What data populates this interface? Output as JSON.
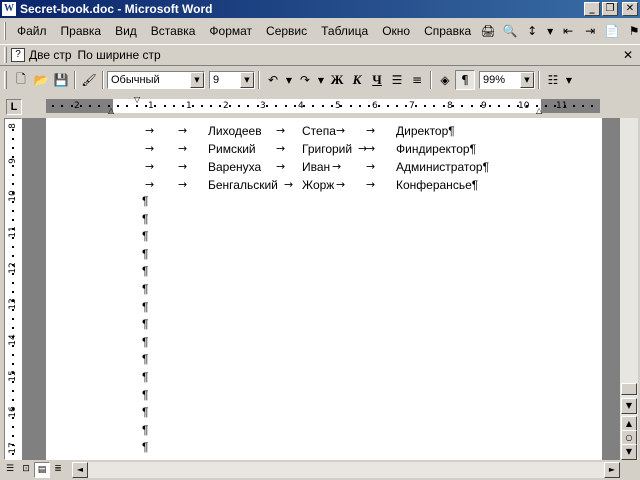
{
  "window": {
    "title": "Secret-book.doc - Microsoft Word",
    "app_icon_letter": "W",
    "minimize_glyph": "_",
    "restore_glyph": "❐",
    "close_glyph": "✕"
  },
  "menu": {
    "items": [
      {
        "label": "Файл"
      },
      {
        "label": "Правка"
      },
      {
        "label": "Вид"
      },
      {
        "label": "Вставка"
      },
      {
        "label": "Формат"
      },
      {
        "label": "Сервис"
      },
      {
        "label": "Таблица"
      },
      {
        "label": "Окно"
      },
      {
        "label": "Справка"
      }
    ],
    "tool_icons": [
      "print-preview-icon",
      "spellcheck-icon",
      "line-spacing-icon",
      "decrease-indent-icon",
      "increase-indent-icon",
      "pdf-icon",
      "bookmark-icon"
    ]
  },
  "reading_toolbar": {
    "two_pages": "Две стр",
    "fit_width": "По ширине стр",
    "close_glyph": "✕"
  },
  "format_toolbar": {
    "style": "Обычный",
    "font_size": "9",
    "bold": "Ж",
    "italic": "К",
    "underline": "Ч",
    "pilcrow": "¶",
    "zoom": "99%"
  },
  "ruler": {
    "tab_selector": "L",
    "numbers": [
      "2",
      "1",
      "1",
      "2",
      "3",
      "4",
      "5",
      "6",
      "7",
      "8",
      "9",
      "10",
      "11",
      "12"
    ]
  },
  "vruler": {
    "numbers": [
      "8",
      "9",
      "10",
      "11",
      "12",
      "13",
      "14",
      "15",
      "16",
      "17"
    ]
  },
  "document": {
    "tab_glyph": "→",
    "pilcrow": "¶",
    "rows": [
      {
        "last": "Лиходеев",
        "first": "Степа",
        "title": "Директор¶"
      },
      {
        "last": "Римский",
        "first": "Григорий",
        "title": "Финдиректор¶"
      },
      {
        "last": "Варенуха",
        "first": "Иван",
        "title": "Администратор¶"
      },
      {
        "last": "Бенгальский",
        "first": "Жорж",
        "title": "Конферансье¶"
      }
    ],
    "empty_paragraph_count": 15
  },
  "scroll": {
    "up": "▲",
    "down": "▼",
    "left": "◄",
    "right": "►",
    "prev_page": "▲",
    "browse": "○",
    "next_page": "▼"
  },
  "colors": {
    "titlebar_start": "#0a246a",
    "titlebar_end": "#3a6ea5",
    "chrome": "#d4d0c8",
    "workspace": "#808080"
  }
}
